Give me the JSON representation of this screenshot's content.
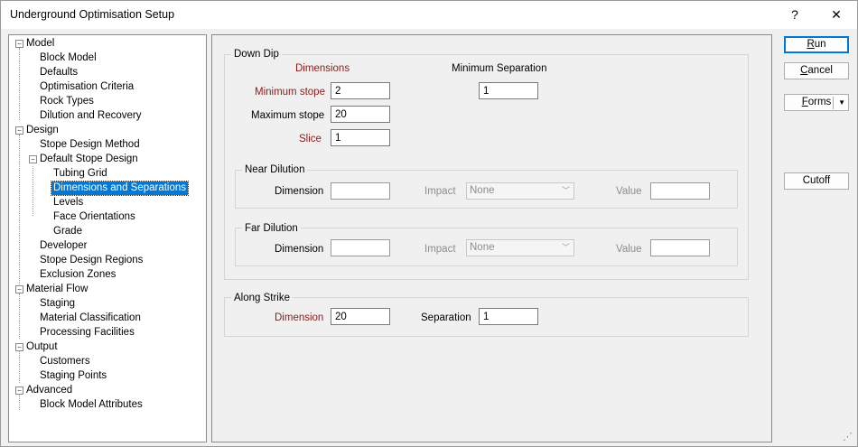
{
  "window": {
    "title": "Underground Optimisation Setup",
    "help": "?",
    "close": "✕"
  },
  "tree": {
    "model": "Model",
    "block_model": "Block Model",
    "defaults": "Defaults",
    "optimisation_criteria": "Optimisation Criteria",
    "rock_types": "Rock Types",
    "dilution_recovery": "Dilution and Recovery",
    "design": "Design",
    "stope_design_method": "Stope Design Method",
    "default_stope_design": "Default Stope Design",
    "tubing_grid": "Tubing Grid",
    "dimensions_separations": "Dimensions and Separations",
    "levels": "Levels",
    "face_orientations": "Face Orientations",
    "grade": "Grade",
    "developer": "Developer",
    "stope_design_regions": "Stope Design Regions",
    "exclusion_zones": "Exclusion Zones",
    "material_flow": "Material Flow",
    "staging": "Staging",
    "material_classification": "Material Classification",
    "processing_facilities": "Processing Facilities",
    "output": "Output",
    "customers": "Customers",
    "staging_points": "Staging Points",
    "advanced": "Advanced",
    "block_model_attributes": "Block Model Attributes"
  },
  "down_dip": {
    "title": "Down Dip",
    "dimensions_header": "Dimensions",
    "min_sep_header": "Minimum Separation",
    "minimum_stope_label": "Minimum stope",
    "minimum_stope_value": "2",
    "min_separation_value": "1",
    "maximum_stope_label": "Maximum stope",
    "maximum_stope_value": "20",
    "slice_label": "Slice",
    "slice_value": "1",
    "near": {
      "title": "Near Dilution",
      "dimension_label": "Dimension",
      "dimension_value": "",
      "impact_label": "Impact",
      "impact_value": "None",
      "value_label": "Value",
      "value_value": ""
    },
    "far": {
      "title": "Far Dilution",
      "dimension_label": "Dimension",
      "dimension_value": "",
      "impact_label": "Impact",
      "impact_value": "None",
      "value_label": "Value",
      "value_value": ""
    }
  },
  "along_strike": {
    "title": "Along Strike",
    "dimension_label": "Dimension",
    "dimension_value": "20",
    "separation_label": "Separation",
    "separation_value": "1"
  },
  "buttons": {
    "run_u": "R",
    "run_rest": "un",
    "cancel_u": "C",
    "cancel_rest": "ancel",
    "forms_u": "F",
    "forms_rest": "orms",
    "forms_arrow": "▼",
    "cutoff": "Cutoff"
  },
  "icons": {
    "expand": "−",
    "resize": "⋰"
  }
}
